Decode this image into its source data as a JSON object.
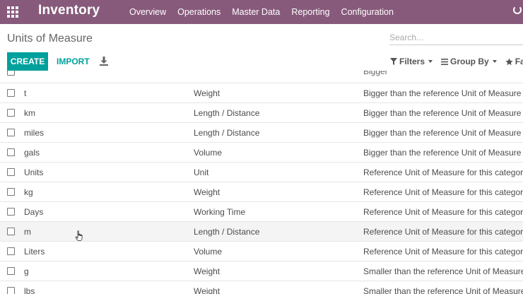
{
  "navbar": {
    "apps_icon": "apps-grid-icon",
    "brand": "Inventory",
    "menu": [
      {
        "label": "Overview"
      },
      {
        "label": "Operations"
      },
      {
        "label": "Master Data"
      },
      {
        "label": "Reporting"
      },
      {
        "label": "Configuration"
      }
    ]
  },
  "page": {
    "title": "Units of Measure",
    "search_placeholder": "Search..."
  },
  "toolbar": {
    "create_label": "CREATE",
    "import_label": "IMPORT",
    "download_icon": "download-icon",
    "filters_label": "Filters",
    "group_by_label": "Group By",
    "favorites_label": "Favor"
  },
  "list": {
    "partial_top_text": "Bigger",
    "rows": [
      {
        "name": "t",
        "category": "Weight",
        "type": "Bigger than the reference Unit of Measure"
      },
      {
        "name": "km",
        "category": "Length / Distance",
        "type": "Bigger than the reference Unit of Measure"
      },
      {
        "name": "miles",
        "category": "Length / Distance",
        "type": "Bigger than the reference Unit of Measure"
      },
      {
        "name": "gals",
        "category": "Volume",
        "type": "Bigger than the reference Unit of Measure"
      },
      {
        "name": "Units",
        "category": "Unit",
        "type": "Reference Unit of Measure for this category"
      },
      {
        "name": "kg",
        "category": "Weight",
        "type": "Reference Unit of Measure for this category"
      },
      {
        "name": "Days",
        "category": "Working Time",
        "type": "Reference Unit of Measure for this category"
      },
      {
        "name": "m",
        "category": "Length / Distance",
        "type": "Reference Unit of Measure for this category"
      },
      {
        "name": "Liters",
        "category": "Volume",
        "type": "Reference Unit of Measure for this category"
      },
      {
        "name": "g",
        "category": "Weight",
        "type": "Smaller than the reference Unit of Measure"
      },
      {
        "name": "lbs",
        "category": "Weight",
        "type": "Smaller than the reference Unit of Measure"
      }
    ]
  },
  "colors": {
    "navbar": "#875a7b",
    "primary": "#00a09d"
  }
}
